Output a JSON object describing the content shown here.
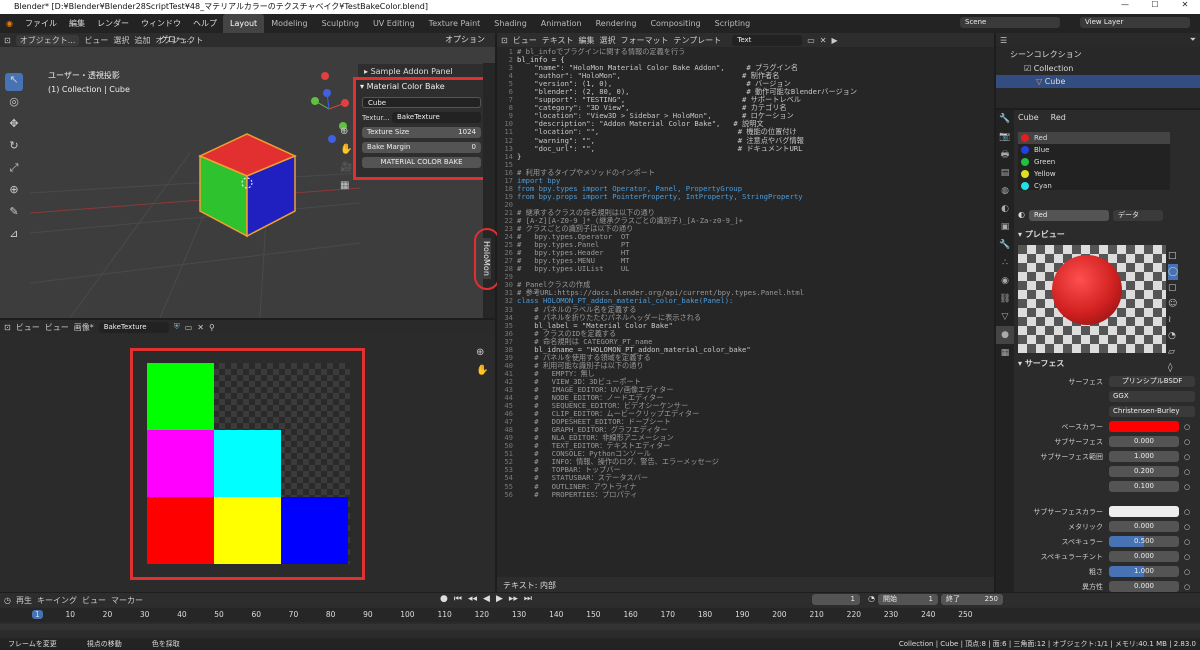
{
  "titlebar": {
    "title": "Blender* [D:¥Blender¥Blender28ScriptTest¥48_マテリアルカラーのテクスチャベイク¥TestBakeColor.blend]",
    "min": "—",
    "max": "☐",
    "close": "✕"
  },
  "menu": [
    "ファイル",
    "編集",
    "レンダー",
    "ウィンドウ",
    "ヘルプ"
  ],
  "workspaces": [
    "Layout",
    "Modeling",
    "Sculpting",
    "UV Editing",
    "Texture Paint",
    "Shading",
    "Animation",
    "Rendering",
    "Compositing",
    "Scripting"
  ],
  "scene": "Scene",
  "view_layer": "View Layer",
  "viewport": {
    "mode": "オブジェクト...",
    "global": "グロー...",
    "options": "オプション",
    "menus": [
      "ビュー",
      "選択",
      "追加",
      "オブジェクト"
    ],
    "info1": "ユーザー・透視投影",
    "info2": "(1) Collection | Cube"
  },
  "npanel": {
    "sample": "Sample Addon Panel",
    "title": "Material Color Bake",
    "object": "Cube",
    "tex_label": "Textur...",
    "tex_value": "BakeTexture",
    "size_label": "Texture Size",
    "size_value": "1024",
    "margin_label": "Bake Margin",
    "margin_value": "0",
    "button": "MATERIAL COLOR BAKE",
    "tab": "HoloMon"
  },
  "image_editor": {
    "menus": [
      "ビュー",
      "ビュー",
      "画像*"
    ],
    "image": "BakeTexture"
  },
  "text_editor": {
    "menus": [
      "ビュー",
      "テキスト",
      "編集",
      "選択",
      "フォーマット",
      "テンプレート"
    ],
    "name": "Text",
    "footer": "テキスト: 内部"
  },
  "code": [
    [
      "1",
      "# bl_infoでプラグインに関する情報の定義を行う"
    ],
    [
      "2",
      "bl_info = {"
    ],
    [
      "3",
      "    \"name\": \"HoloMon Material Color Bake Addon\",     # プラグイン名"
    ],
    [
      "4",
      "    \"author\": \"HoloMon\",                            # 制作者名"
    ],
    [
      "5",
      "    \"version\": (1, 0),                               # バージョン"
    ],
    [
      "6",
      "    \"blender\": (2, 80, 0),                           # 動作可能なBlenderバージョン"
    ],
    [
      "7",
      "    \"support\": \"TESTING\",                           # サポートレベル"
    ],
    [
      "8",
      "    \"category\": \"3D View\",                          # カテゴリ名"
    ],
    [
      "9",
      "    \"location\": \"View3D > Sidebar > HoloMon\",       # ロケーション"
    ],
    [
      "10",
      "    \"description\": \"Addon Material Color Bake\",   # 説明文"
    ],
    [
      "11",
      "    \"location\": \"\",                                # 機能の位置付け"
    ],
    [
      "12",
      "    \"warning\": \"\",                                 # 注意点やバグ情報"
    ],
    [
      "13",
      "    \"doc_url\": \"\",                                 # ドキュメントURL"
    ],
    [
      "14",
      "}"
    ],
    [
      "15",
      ""
    ],
    [
      "16",
      "# 利用するタイプやメソッドのインポート"
    ],
    [
      "17",
      "import bpy"
    ],
    [
      "18",
      "from bpy.types import Operator, Panel, PropertyGroup"
    ],
    [
      "19",
      "from bpy.props import PointerProperty, IntProperty, StringProperty"
    ],
    [
      "20",
      ""
    ],
    [
      "21",
      "# 継承するクラスの命名規則は以下の通り"
    ],
    [
      "22",
      "# [A-Z][A-Z0-9_]*_(継承クラスごとの識別子)_[A-Za-z0-9_]+"
    ],
    [
      "23",
      "# クラスごとの識別子は以下の通り"
    ],
    [
      "24",
      "#   bpy.types.Operator  OT"
    ],
    [
      "25",
      "#   bpy.types.Panel     PT"
    ],
    [
      "26",
      "#   bpy.types.Header    HT"
    ],
    [
      "27",
      "#   bpy.types.MENU      MT"
    ],
    [
      "28",
      "#   bpy.types.UIList    UL"
    ],
    [
      "29",
      ""
    ],
    [
      "30",
      "# Panelクラスの作成"
    ],
    [
      "31",
      "# 参考URL:https://docs.blender.org/api/current/bpy.types.Panel.html"
    ],
    [
      "32",
      "class HOLOMON_PT_addon_material_color_bake(Panel):"
    ],
    [
      "33",
      "    # パネルのラベル名を定義する"
    ],
    [
      "34",
      "    # パネルを折りたたむパネルヘッダーに表示される"
    ],
    [
      "35",
      "    bl_label = \"Material Color Bake\""
    ],
    [
      "36",
      "    # クラスのIDを定義する"
    ],
    [
      "37",
      "    # 命名規則は CATEGORY_PT_name"
    ],
    [
      "38",
      "    bl_idname = \"HOLOMON_PT_addon_material_color_bake\""
    ],
    [
      "39",
      "    # パネルを使用する領域を定義する"
    ],
    [
      "40",
      "    # 利用可能な識別子は以下の通り"
    ],
    [
      "41",
      "    #   EMPTY：無し"
    ],
    [
      "42",
      "    #   VIEW_3D：3Dビューポート"
    ],
    [
      "43",
      "    #   IMAGE_EDITOR：UV/画像エディター"
    ],
    [
      "44",
      "    #   NODE_EDITOR：ノードエディター"
    ],
    [
      "45",
      "    #   SEQUENCE_EDITOR：ビデオシーケンサー"
    ],
    [
      "46",
      "    #   CLIP_EDITOR：ムービークリップエディター"
    ],
    [
      "47",
      "    #   DOPESHEET_EDITOR：ドープシート"
    ],
    [
      "48",
      "    #   GRAPH_EDITOR：グラフエディター"
    ],
    [
      "49",
      "    #   NLA_EDITOR：非線形アニメーション"
    ],
    [
      "50",
      "    #   TEXT_EDITOR：テキストエディター"
    ],
    [
      "51",
      "    #   CONSOLE：Pythonコンソール"
    ],
    [
      "52",
      "    #   INFO：情報、操作のログ、警告、エラーメッセージ"
    ],
    [
      "53",
      "    #   TOPBAR：トップバー"
    ],
    [
      "54",
      "    #   STATUSBAR：ステータスバー"
    ],
    [
      "55",
      "    #   OUTLINER：アウトライナ"
    ],
    [
      "56",
      "    #   PROPERTIES：プロパティ"
    ]
  ],
  "outliner": {
    "title": "シーンコレクション",
    "collection": "Collection",
    "cube": "Cube"
  },
  "props": {
    "object": "Cube",
    "material": "Red",
    "slots": [
      {
        "name": "Red",
        "color": "#e02020"
      },
      {
        "name": "Blue",
        "color": "#2040e0"
      },
      {
        "name": "Green",
        "color": "#20c040"
      },
      {
        "name": "Yellow",
        "color": "#e0e020"
      },
      {
        "name": "Cyan",
        "color": "#20e0e0"
      }
    ],
    "mat_name": "Red",
    "data": "データ",
    "preview": "プレビュー",
    "surface_hdr": "サーフェス",
    "surface_label": "サーフェス",
    "surface_value": "プリンシプルBSDF",
    "dist": "GGX",
    "sss_method": "Christensen-Burley",
    "rows": [
      {
        "label": "ベースカラー",
        "value": "",
        "kind": "color-red"
      },
      {
        "label": "サブサーフェス",
        "value": "0.000",
        "kind": "num"
      },
      {
        "label": "サブサーフェス範囲",
        "value": "1.000",
        "kind": "num"
      },
      {
        "label": "",
        "value": "0.200",
        "kind": "num"
      },
      {
        "label": "",
        "value": "0.100",
        "kind": "num"
      },
      {
        "label": "",
        "value": "",
        "kind": "gap"
      },
      {
        "label": "サブサーフェスカラー",
        "value": "",
        "kind": "color-white"
      },
      {
        "label": "メタリック",
        "value": "0.000",
        "kind": "num"
      },
      {
        "label": "スペキュラー",
        "value": "0.500",
        "kind": "blue"
      },
      {
        "label": "スペキュラーチント",
        "value": "0.000",
        "kind": "num"
      },
      {
        "label": "粗さ",
        "value": "1.000",
        "kind": "blue"
      },
      {
        "label": "異方性",
        "value": "0.000",
        "kind": "num"
      },
      {
        "label": "異方性の回転",
        "value": "0.000",
        "kind": "num"
      },
      {
        "label": "シーン",
        "value": "0.000",
        "kind": "num"
      },
      {
        "label": "シーンチント",
        "value": "0.500",
        "kind": "blue"
      }
    ]
  },
  "timeline": {
    "menus": [
      "再生",
      "キーイング",
      "ビュー",
      "マーカー"
    ],
    "current": "1",
    "start_label": "開始",
    "start": "1",
    "end_label": "終了",
    "end": "250",
    "ticks": [
      "1",
      "10",
      "20",
      "30",
      "40",
      "50",
      "60",
      "70",
      "80",
      "90",
      "100",
      "110",
      "120",
      "130",
      "140",
      "150",
      "160",
      "170",
      "180",
      "190",
      "200",
      "210",
      "220",
      "230",
      "240",
      "250"
    ]
  },
  "statusbar": {
    "left1": "フレームを変更",
    "left2": "視点の移動",
    "left3": "色を採取",
    "right": "Collection | Cube | 頂点:8 | 面:6 | 三角面:12 | オブジェクト:1/1 | メモリ:40.1 MB | 2.83.0"
  },
  "colors": {
    "accent": "#4772b3",
    "highlight": "#e03030"
  }
}
